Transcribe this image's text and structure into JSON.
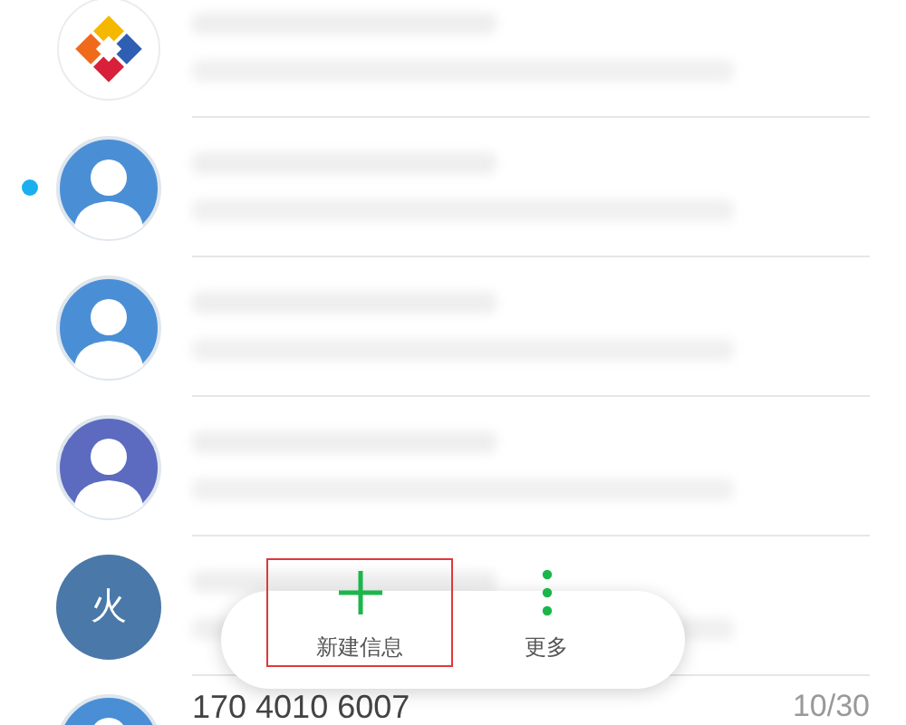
{
  "conversations": [
    {
      "avatar": {
        "kind": "logo"
      },
      "unread": false
    },
    {
      "avatar": {
        "kind": "person",
        "color": "#4a8fd6"
      },
      "unread": true
    },
    {
      "avatar": {
        "kind": "person",
        "color": "#4a8fd6"
      },
      "unread": false
    },
    {
      "avatar": {
        "kind": "person",
        "color": "#5c6bc0"
      },
      "unread": false
    },
    {
      "avatar": {
        "kind": "letter",
        "color": "#4a78a8",
        "letter": "火"
      },
      "unread": false
    },
    {
      "avatar": {
        "kind": "person",
        "color": "#4a8fd6"
      },
      "unread": false,
      "sender": "170 4010 6007",
      "time": "10/30"
    }
  ],
  "action_bar": {
    "buttons": [
      {
        "kind": "new",
        "label": "新建信息",
        "highlighted": true
      },
      {
        "kind": "more",
        "label": "更多",
        "highlighted": false
      }
    ]
  }
}
